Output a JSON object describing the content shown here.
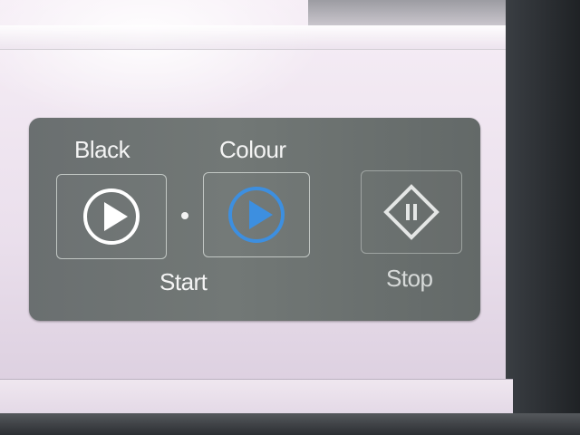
{
  "panel": {
    "black_label": "Black",
    "colour_label": "Colour",
    "start_label": "Start",
    "stop_label": "Stop"
  },
  "icons": {
    "black_start": "play-circle-icon",
    "colour_start": "play-circle-icon",
    "stop": "stop-diamond-icon"
  },
  "colors": {
    "panel_bg": "#6f7473",
    "icon_white": "#ffffff",
    "colour_accent": "#3d8fe0"
  }
}
